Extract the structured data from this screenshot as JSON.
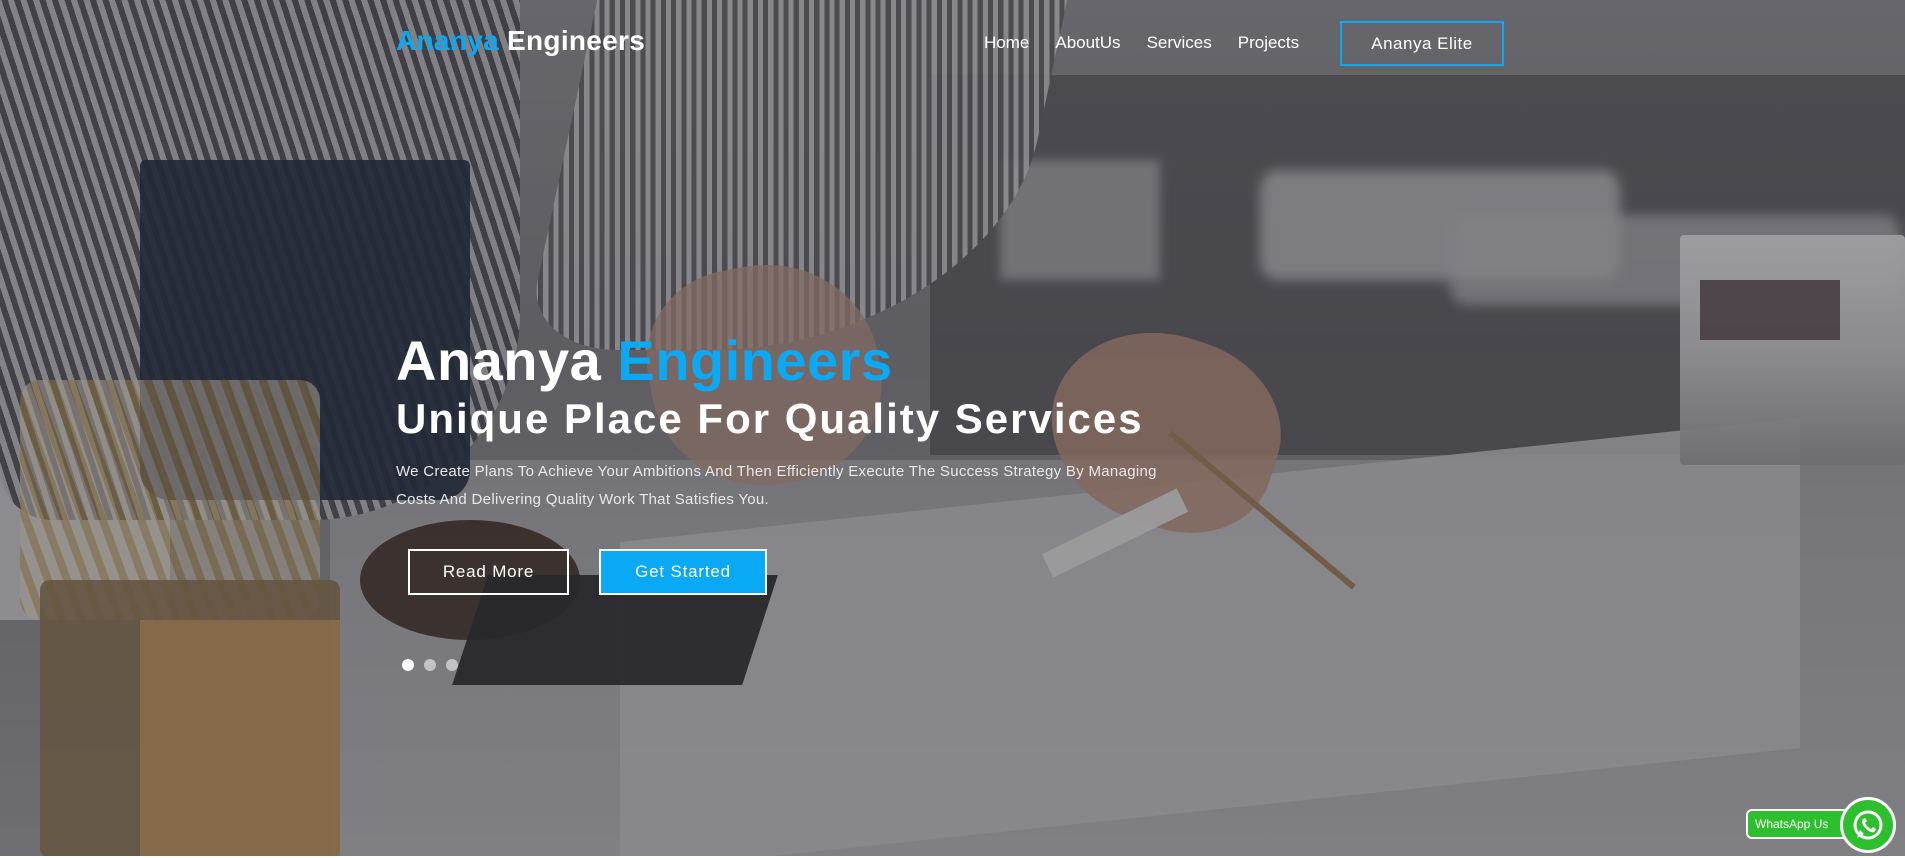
{
  "brand": {
    "name_part1": "Ananya",
    "name_part2": "Engineers",
    "accent_color": "#0aa9f5"
  },
  "nav": {
    "items": [
      {
        "label": "Home"
      },
      {
        "label": "AboutUs"
      },
      {
        "label": "Services"
      },
      {
        "label": "Projects"
      }
    ],
    "cta_label": "Ananya Elite"
  },
  "hero": {
    "title_part1": "Ananya",
    "title_part2": "Engineers",
    "subtitle": "Unique Place For Quality Services",
    "description": "We Create Plans To Achieve Your Ambitions And Then Efficiently Execute The Success Strategy By Managing Costs And Delivering Quality Work That Satisfies You.",
    "read_more_label": "Read More",
    "get_started_label": "Get Started",
    "slides_count": 3,
    "active_slide": 1
  },
  "whatsapp": {
    "label": "WhatsApp Us",
    "icon": "whatsapp-icon",
    "color": "#2ebf2e"
  }
}
